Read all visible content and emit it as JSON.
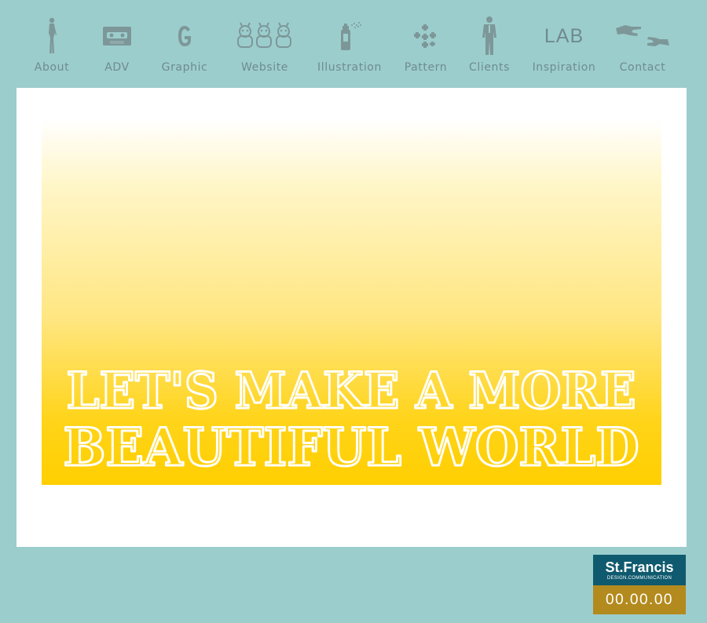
{
  "nav": {
    "items": [
      {
        "label": "About",
        "icon": "woman-silhouette-icon"
      },
      {
        "label": "ADV",
        "icon": "cassette-icon"
      },
      {
        "label": "Graphic",
        "icon": "letter-g-icon"
      },
      {
        "label": "Website",
        "icon": "cartoon-characters-icon"
      },
      {
        "label": "Illustration",
        "icon": "spray-can-icon"
      },
      {
        "label": "Pattern",
        "icon": "pattern-cluster-icon"
      },
      {
        "label": "Clients",
        "icon": "businessman-silhouette-icon"
      },
      {
        "label": "Inspiration",
        "icon_text": "LAB"
      },
      {
        "label": "Contact",
        "icon": "hands-pointing-icon"
      }
    ]
  },
  "banner": {
    "line1": "LET'S MAKE A MORE",
    "line2": "BEAUTIFUL WORLD"
  },
  "brand": {
    "name": "St.Francis",
    "tagline": "DESIGN.COMMUNICATION",
    "clock": "00.00.00"
  },
  "colors": {
    "background": "#9ccdcd",
    "nav_gray": "#6f8b8e",
    "banner_yellow": "#ffcf00",
    "brand_teal": "#0f5a6e",
    "brand_gold": "#b38a1e"
  }
}
